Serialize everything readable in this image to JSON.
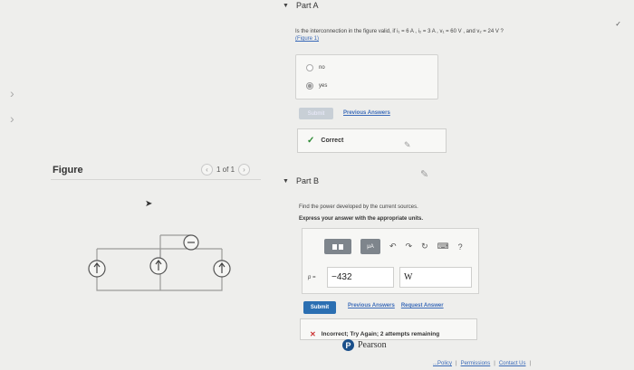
{
  "part_a": {
    "title": "Part A",
    "question": "Is the interconnection in the figure valid, if i₁ = 6 A , i₂ = 3 A , v₁ = 60 V , and v₂ = 24 V ?",
    "figure_link": "(Figure 1)",
    "options": [
      {
        "label": "no",
        "selected": false
      },
      {
        "label": "yes",
        "selected": true
      }
    ],
    "submit_label": "Submit",
    "previous_answers_label": "Previous Answers",
    "feedback": "Correct"
  },
  "figure": {
    "label": "Figure",
    "pager_text": "1 of 1"
  },
  "part_b": {
    "title": "Part B",
    "prompt": "Find the power developed by the current sources.",
    "instruction": "Express your answer with the appropriate units.",
    "toolbar": {
      "units_label": "μA",
      "help_label": "?"
    },
    "variable_label": "p =",
    "value": "−432",
    "unit": "W",
    "submit_label": "Submit",
    "previous_answers_label": "Previous Answers",
    "request_answer_label": "Request Answer",
    "feedback": "Incorrect; Try Again; 2 attempts remaining"
  },
  "brand": {
    "name": "Pearson"
  },
  "footer": {
    "partial_label": "...Policy",
    "permissions_label": "Permissions",
    "contact_label": "Contact Us"
  },
  "colors": {
    "accent": "#2b6fb2",
    "correct": "#2d8a34",
    "incorrect": "#cc3333"
  }
}
